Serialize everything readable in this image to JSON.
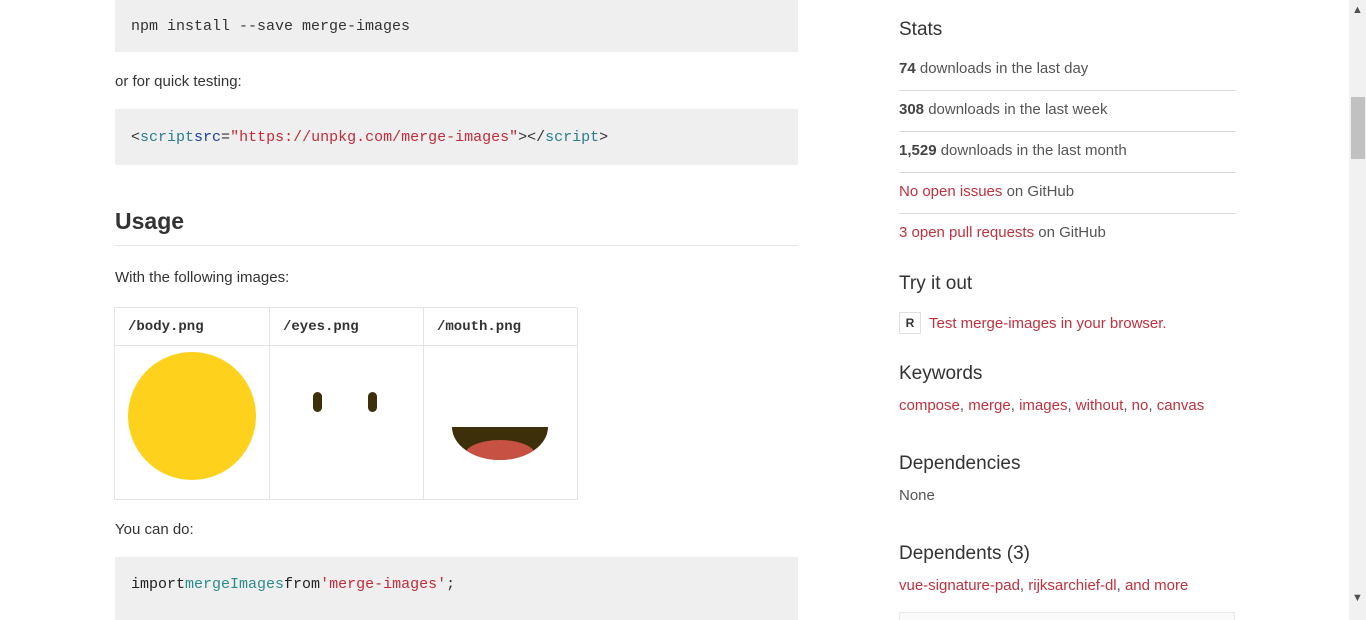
{
  "install": {
    "npm_command": "npm install --save merge-images",
    "quick_testing_text": "or for quick testing:",
    "script_open_tag": "<",
    "script_tag": "script",
    "script_attr": "src",
    "script_eq": "=",
    "script_url": "\"https://unpkg.com/merge-images\"",
    "script_mid": "></",
    "script_close": ">"
  },
  "usage": {
    "heading": "Usage",
    "intro": "With the following images:",
    "table_headers": [
      "/body.png",
      "/eyes.png",
      "/mouth.png"
    ],
    "outro": "You can do:",
    "code": {
      "import_kw": "import",
      "name": "mergeImages",
      "from_kw": "from",
      "module": "'merge-images'",
      "semicolon": ";"
    }
  },
  "sidebar": {
    "stats_heading": "Stats",
    "stats": [
      {
        "count": "74",
        "label": " downloads in the last day"
      },
      {
        "count": "308",
        "label": " downloads in the last week"
      },
      {
        "count": "1,529",
        "label": " downloads in the last month"
      }
    ],
    "issues_link": "No open issues",
    "issues_suffix": " on GitHub",
    "prs_link": "3 open pull requests",
    "prs_suffix": " on GitHub",
    "try_heading": "Try it out",
    "runkit_badge": "R",
    "try_link": "Test merge-images in your browser.",
    "keywords_heading": "Keywords",
    "keywords": [
      "compose",
      "merge",
      "images",
      "without",
      "no",
      "canvas"
    ],
    "keyword_sep": ", ",
    "deps_heading": "Dependencies",
    "deps_value": "None",
    "dependents_heading": "Dependents (3)",
    "dependents": [
      "vue-signature-pad",
      "rijksarchief-dl"
    ],
    "dependents_more": "and more",
    "dependents_sep": ", "
  },
  "colors": {
    "link_red": "#c0313f",
    "face_yellow": "#fdd11c",
    "feature_brown": "#3d2f0a",
    "tongue_red": "#c75142"
  }
}
